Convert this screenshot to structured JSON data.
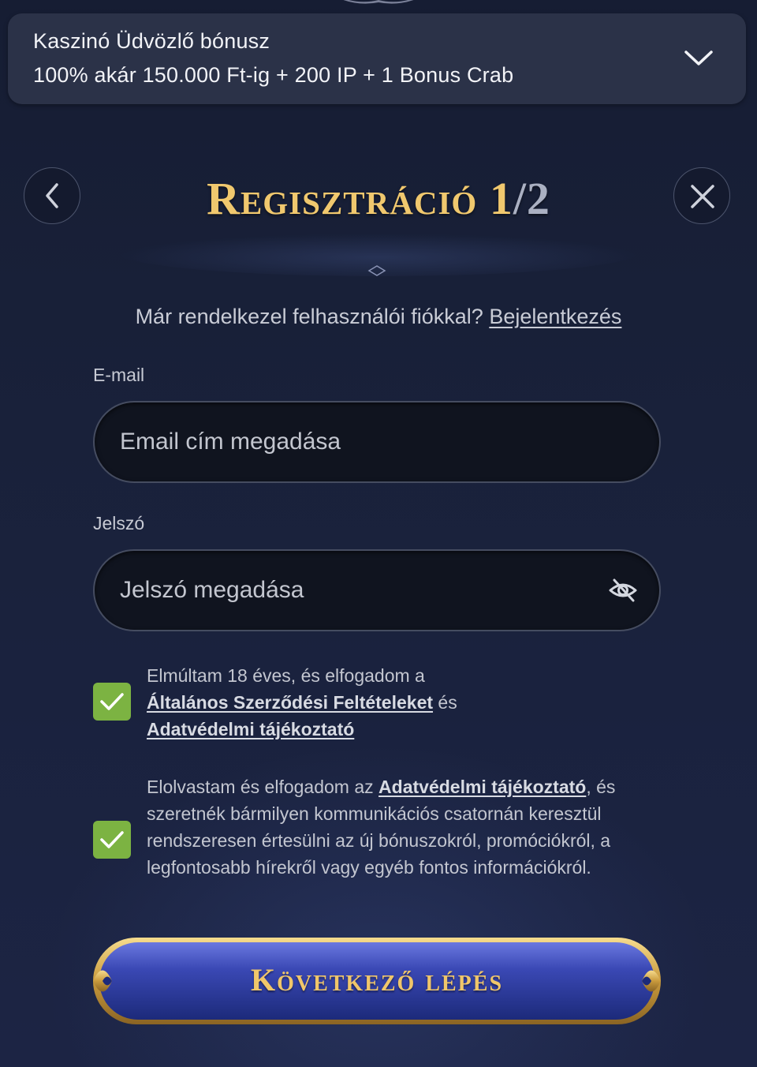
{
  "bonus": {
    "title": "Kaszinó Üdvözlő bónusz",
    "subtitle": "100% akár 150.000 Ft-ig + 200 IP + 1 Bonus Crab"
  },
  "header": {
    "title": "Regisztráció",
    "step_current": "1",
    "step_total": "/2"
  },
  "login_prompt": {
    "text": "Már rendelkezel felhasználói fiókkal?",
    "link": "Bejelentkezés"
  },
  "email": {
    "label": "E-mail",
    "placeholder": "Email cím megadása",
    "value": ""
  },
  "password": {
    "label": "Jelszó",
    "placeholder": "Jelszó megadása",
    "value": ""
  },
  "consent_age": {
    "checked": true,
    "text_before": "Elmúltam 18 éves, és elfogadom a",
    "link_terms": "Általános Szerződési Feltételeket",
    "text_and": "és",
    "link_privacy": "Adatvédelmi tájékoztató"
  },
  "consent_marketing": {
    "checked": true,
    "text_before": "Elolvastam és elfogadom az",
    "link_privacy": "Adatvédelmi tájékoztató",
    "text_after": ", és szeretnék bármilyen kommunikációs csatornán keresztül rendszeresen értesülni az új bónuszokról, promóciókról, a legfontosabb hírekről vagy egyéb fontos információkról."
  },
  "next_button": {
    "label": "Következő lépés"
  },
  "icons": {
    "bonus_toggle": "chevron-down-icon",
    "back": "chevron-left-icon",
    "close": "close-icon",
    "password_toggle": "eye-off-icon",
    "check": "checkmark-icon"
  },
  "colors": {
    "background": "#182038",
    "gold": "#f0c86e",
    "checkbox_green": "#7cb342",
    "button_blue": "#2c3aa0"
  }
}
